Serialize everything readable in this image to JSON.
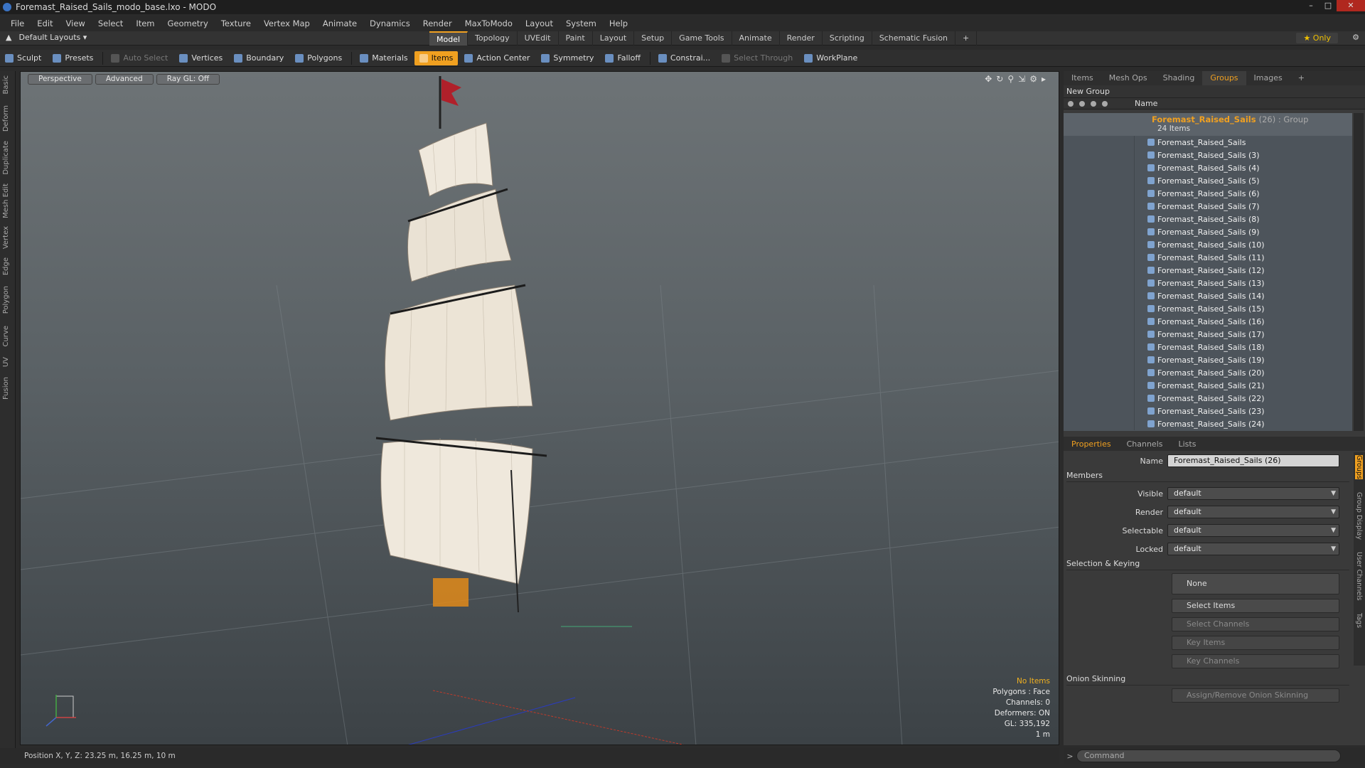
{
  "window": {
    "title": "Foremast_Raised_Sails_modo_base.lxo - MODO"
  },
  "menu": [
    "File",
    "Edit",
    "View",
    "Select",
    "Item",
    "Geometry",
    "Texture",
    "Vertex Map",
    "Animate",
    "Dynamics",
    "Render",
    "MaxToModo",
    "Layout",
    "System",
    "Help"
  ],
  "layout_selector": "Default Layouts ▾",
  "mode_tabs": [
    "Model",
    "Topology",
    "UVEdit",
    "Paint",
    "Layout",
    "Setup",
    "Game Tools",
    "Animate",
    "Render",
    "Scripting",
    "Schematic Fusion"
  ],
  "active_mode_tab": "Model",
  "only_button": "★  Only",
  "toolbar": {
    "sculpt": "Sculpt",
    "presets": "Presets",
    "auto_select": "Auto Select",
    "vertices": "Vertices",
    "boundary": "Boundary",
    "polygons": "Polygons",
    "materials": "Materials",
    "items": "Items",
    "action_center": "Action Center",
    "symmetry": "Symmetry",
    "falloff": "Falloff",
    "constraints": "Constrai...",
    "select_through": "Select Through",
    "workplane": "WorkPlane"
  },
  "left_strip_tabs": [
    "Basic",
    "Deform",
    "Duplicate",
    "Mesh Edit",
    "Vertex",
    "Edge",
    "Polygon",
    "Curve",
    "UV",
    "Fusion"
  ],
  "viewport": {
    "view_buttons": [
      "Perspective",
      "Advanced",
      "Ray GL: Off"
    ],
    "info": {
      "selection": "No Items",
      "polygons": "Polygons : Face",
      "channels": "Channels: 0",
      "deformers": "Deformers: ON",
      "gl": "GL: 335,192",
      "scale": "1 m"
    }
  },
  "panel_tabs": [
    "Items",
    "Mesh Ops",
    "Shading",
    "Groups",
    "Images"
  ],
  "active_panel_tab": "Groups",
  "groups": {
    "new_group": "New Group",
    "col_name": "Name",
    "group_name": "Foremast_Raised_Sails",
    "group_suffix": "(26) : Group",
    "group_count": "24 Items",
    "items": [
      "Foremast_Raised_Sails",
      "Foremast_Raised_Sails (3)",
      "Foremast_Raised_Sails (4)",
      "Foremast_Raised_Sails (5)",
      "Foremast_Raised_Sails (6)",
      "Foremast_Raised_Sails (7)",
      "Foremast_Raised_Sails (8)",
      "Foremast_Raised_Sails (9)",
      "Foremast_Raised_Sails (10)",
      "Foremast_Raised_Sails (11)",
      "Foremast_Raised_Sails (12)",
      "Foremast_Raised_Sails (13)",
      "Foremast_Raised_Sails (14)",
      "Foremast_Raised_Sails (15)",
      "Foremast_Raised_Sails (16)",
      "Foremast_Raised_Sails (17)",
      "Foremast_Raised_Sails (18)",
      "Foremast_Raised_Sails (19)",
      "Foremast_Raised_Sails (20)",
      "Foremast_Raised_Sails (21)",
      "Foremast_Raised_Sails (22)",
      "Foremast_Raised_Sails (23)",
      "Foremast_Raised_Sails (24)"
    ]
  },
  "prop_tabs": [
    "Properties",
    "Channels",
    "Lists"
  ],
  "properties": {
    "name_label": "Name",
    "name_value": "Foremast_Raised_Sails (26)",
    "members_section": "Members",
    "visible_label": "Visible",
    "visible_value": "default",
    "render_label": "Render",
    "render_value": "default",
    "selectable_label": "Selectable",
    "selectable_value": "default",
    "locked_label": "Locked",
    "locked_value": "default",
    "selection_section": "Selection & Keying",
    "none_btn": "None",
    "select_items": "Select Items",
    "select_channels": "Select Channels",
    "key_items": "Key Items",
    "key_channels": "Key Channels",
    "onion_section": "Onion Skinning",
    "onion_btn": "Assign/Remove Onion Skinning"
  },
  "side_tabs": [
    "Groups",
    "Group Display",
    "User Channels",
    "Tags"
  ],
  "status": {
    "position": "Position X, Y, Z:  23.25 m, 16.25 m, 10 m"
  },
  "command": {
    "placeholder": "Command"
  },
  "colors": {
    "accent": "#f0a020",
    "sail": "#efe8dc",
    "flag": "#b0202a"
  }
}
